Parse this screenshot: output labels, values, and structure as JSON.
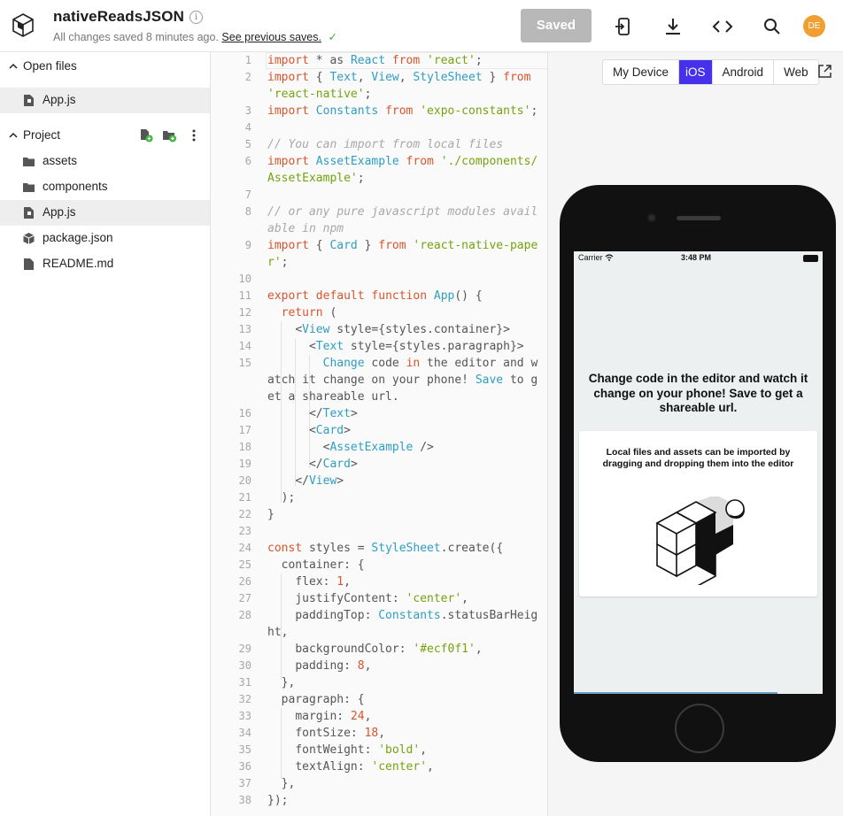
{
  "header": {
    "project_name": "nativeReadsJSON",
    "info_icon": "i",
    "status_text": "All changes saved 8 minutes ago.",
    "previous_saves_link": "See previous saves.",
    "check_mark": "✓",
    "saved_button": "Saved",
    "avatar_initials": "DE",
    "icons": [
      "run-on-device-icon",
      "download-icon",
      "embed-code-icon",
      "search-icon"
    ]
  },
  "sidebar": {
    "open_files_label": "Open files",
    "open_files": [
      {
        "name": "App.js",
        "icon": "js-file-icon",
        "active": true
      }
    ],
    "project_label": "Project",
    "project_items": [
      {
        "name": "assets",
        "icon": "folder-icon"
      },
      {
        "name": "components",
        "icon": "folder-icon"
      },
      {
        "name": "App.js",
        "icon": "js-file-icon",
        "active": true
      },
      {
        "name": "package.json",
        "icon": "package-icon"
      },
      {
        "name": "README.md",
        "icon": "markdown-file-icon"
      }
    ]
  },
  "editor": {
    "line_numbers": [
      "1",
      "2",
      "3",
      "4",
      "5",
      "6",
      "7",
      "8",
      "9",
      "10",
      "11",
      "12",
      "13",
      "14",
      "15",
      "16",
      "17",
      "18",
      "19",
      "20",
      "21",
      "22",
      "23",
      "24",
      "25",
      "26",
      "27",
      "28",
      "29",
      "30",
      "31",
      "32",
      "33",
      "34",
      "35",
      "36",
      "37",
      "38"
    ]
  },
  "preview": {
    "platform_tabs": [
      "My Device",
      "iOS",
      "Android",
      "Web"
    ],
    "selected_platform": "iOS",
    "status_carrier": "Carrier",
    "status_time": "3:48 PM",
    "paragraph": "Change code in the editor and watch it change on your phone! Save to get a shareable url.",
    "card_text": "Local files and assets can be imported by dragging and dropping them into the editor",
    "background_color": "#ecf0f1"
  },
  "colors": {
    "accent": "#4630eb",
    "keyword": "#d9542b",
    "identifier": "#2e9ec2",
    "string": "#74a30f",
    "saved_button_bg": "#b8b8b8",
    "avatar_bg": "#f0a030"
  }
}
